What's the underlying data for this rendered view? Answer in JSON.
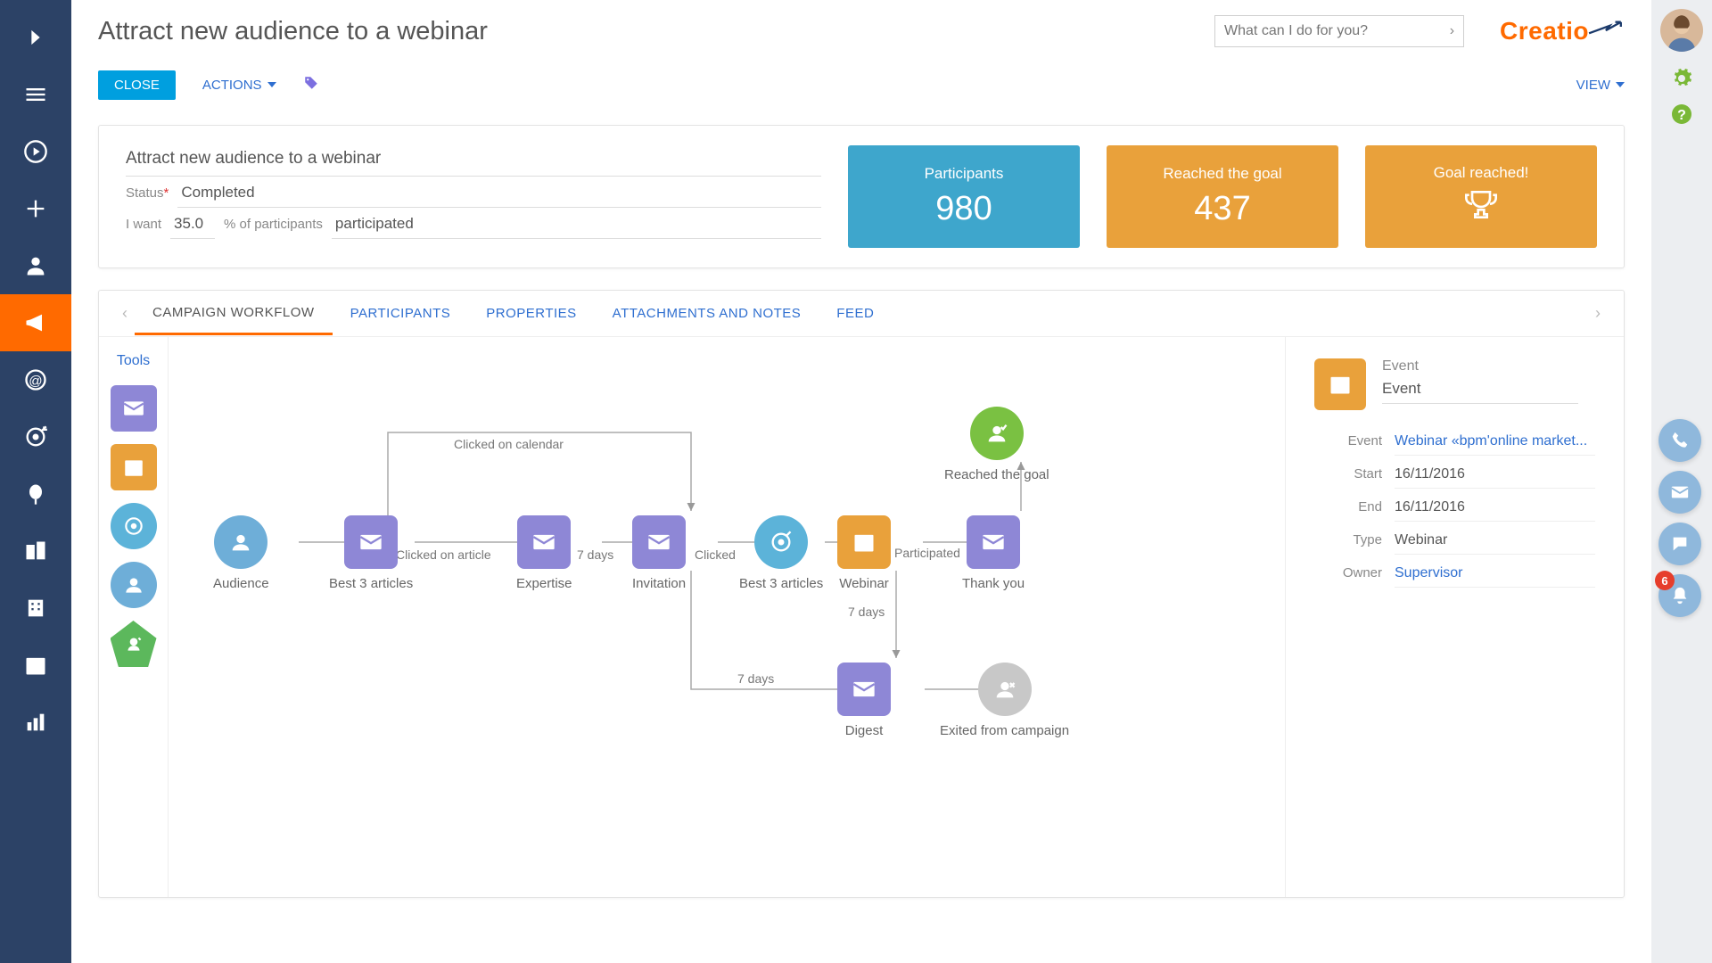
{
  "header": {
    "title": "Attract new audience to a webinar",
    "search_placeholder": "What can I do for you?",
    "logo_text": "Creatio"
  },
  "toolbar": {
    "close": "CLOSE",
    "actions": "ACTIONS",
    "view": "VIEW"
  },
  "info": {
    "name": "Attract new audience to a webinar",
    "status_label": "Status",
    "status_value": "Completed",
    "iwant_label": "I want",
    "iwant_value": "35.0",
    "pct_label": "% of participants",
    "pct_value": "participated",
    "card_participants_label": "Participants",
    "card_participants_value": "980",
    "card_reached_label": "Reached the goal",
    "card_reached_value": "437",
    "card_goal_label": "Goal reached!"
  },
  "tabs": {
    "t0": "CAMPAIGN WORKFLOW",
    "t1": "PARTICIPANTS",
    "t2": "PROPERTIES",
    "t3": "ATTACHMENTS AND NOTES",
    "t4": "FEED"
  },
  "tools_title": "Tools",
  "workflow": {
    "nodes": {
      "audience": "Audience",
      "best3a": "Best 3 articles",
      "expertise": "Expertise",
      "invitation": "Invitation",
      "best3b": "Best 3 articles",
      "webinar": "Webinar",
      "thankyou": "Thank you",
      "reached": "Reached the goal",
      "digest": "Digest",
      "exited": "Exited from campaign"
    },
    "edges": {
      "clicked_article": "Clicked on article",
      "clicked_calendar": "Clicked on calendar",
      "seven_days": "7 days",
      "clicked": "Clicked",
      "participated": "Participated"
    }
  },
  "details": {
    "header_label": "Event",
    "header_value": "Event",
    "rows": {
      "event_label": "Event",
      "event_value": "Webinar «bpm'online market...",
      "start_label": "Start",
      "start_value": "16/11/2016",
      "end_label": "End",
      "end_value": "16/11/2016",
      "type_label": "Type",
      "type_value": "Webinar",
      "owner_label": "Owner",
      "owner_value": "Supervisor"
    }
  },
  "notifications_badge": "6"
}
